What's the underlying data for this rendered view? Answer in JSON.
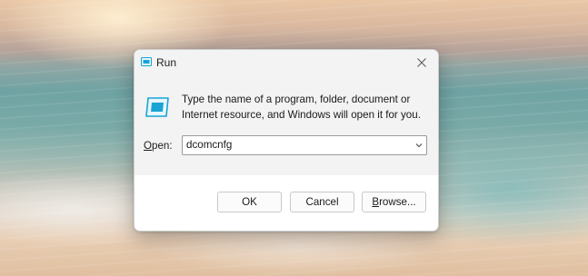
{
  "window": {
    "title": "Run",
    "icon": "run-icon"
  },
  "dialog": {
    "description": "Type the name of a program, folder, document or Internet resource, and Windows will open it for you.",
    "open_label_accel": "O",
    "open_label_rest": "pen:",
    "open_value": "dcomcnfg"
  },
  "buttons": {
    "ok": "OK",
    "cancel": "Cancel",
    "browse_accel": "B",
    "browse_rest": "rowse..."
  },
  "colors": {
    "accent": "#1aa3d4",
    "dialog_bg": "#f3f3f3"
  }
}
